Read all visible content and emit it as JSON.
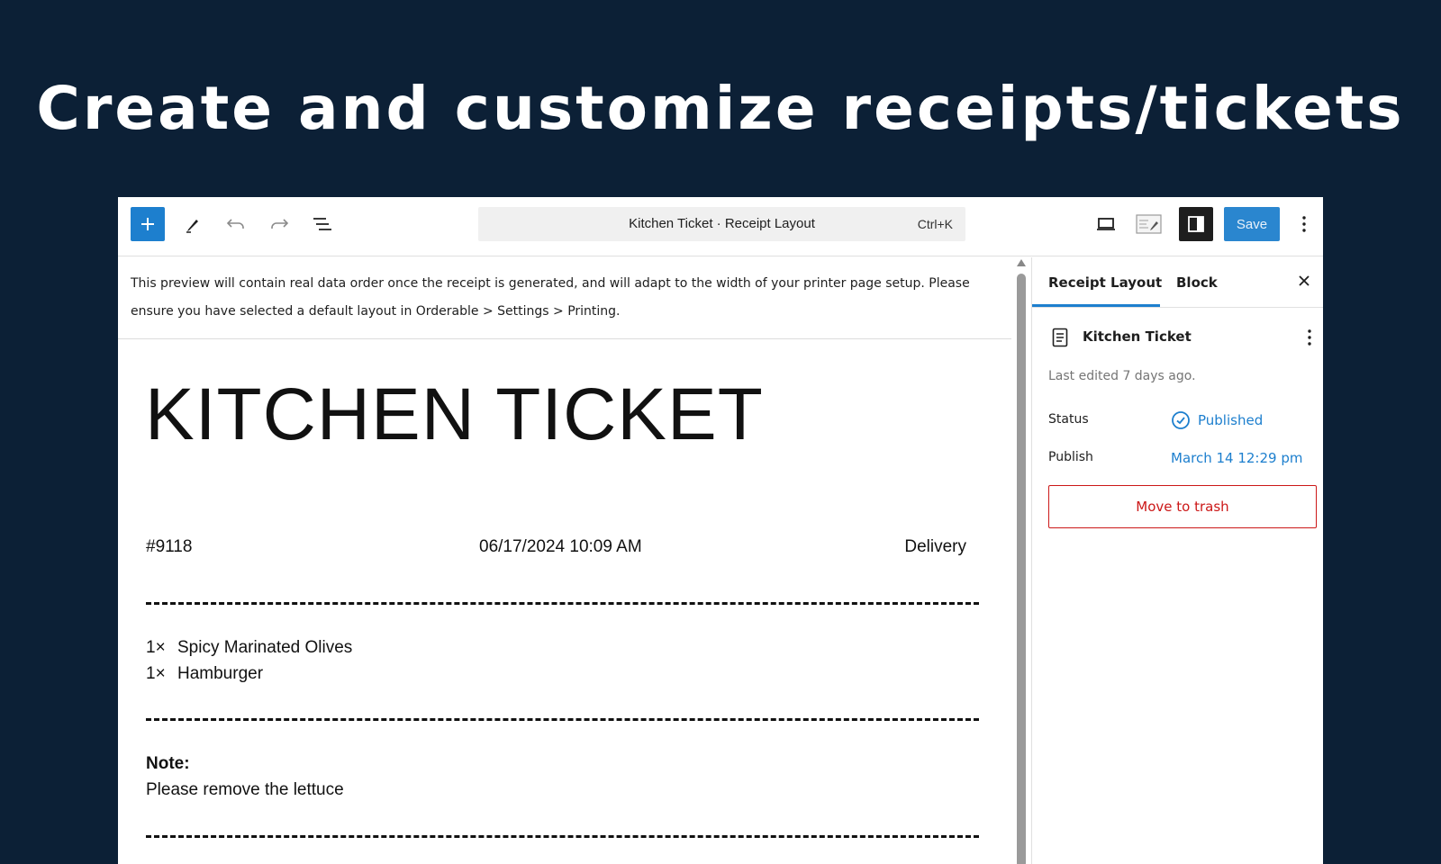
{
  "headline": "Create and customize receipts/tickets",
  "toolbar": {
    "command_title": "Kitchen Ticket · Receipt Layout",
    "command_shortcut": "Ctrl+K",
    "save_label": "Save",
    "icons": [
      "plus-icon",
      "pen-icon",
      "undo-icon",
      "redo-icon",
      "list-view-icon",
      "desktop-view-icon",
      "edit-mode-icon",
      "sidebar-toggle-icon",
      "more-options-icon"
    ]
  },
  "editor": {
    "notice": "This preview will contain real data order once the receipt is generated, and will adapt to the width of your printer page setup. Please ensure you have selected a default layout in Orderable > Settings > Printing.",
    "ticket": {
      "title": "KITCHEN TICKET",
      "order_number": "#9118",
      "date": "06/17/2024 10:09 AM",
      "type": "Delivery",
      "items": [
        {
          "qty": "1×",
          "name": "Spicy Marinated Olives"
        },
        {
          "qty": "1×",
          "name": "Hamburger"
        }
      ],
      "note_label": "Note:",
      "note_text": "Please remove the lettuce"
    }
  },
  "sidebar": {
    "tabs": [
      "Receipt Layout",
      "Block"
    ],
    "active_tab": "Receipt Layout",
    "document_name": "Kitchen Ticket",
    "last_edited": "Last edited 7 days ago.",
    "status_label": "Status",
    "status_value": "Published",
    "publish_label": "Publish",
    "publish_value": "March 14 12:29 pm",
    "trash_label": "Move to trash"
  },
  "colors": {
    "background": "#0c2036",
    "accent": "#1d7fce",
    "danger": "#cc1818"
  }
}
